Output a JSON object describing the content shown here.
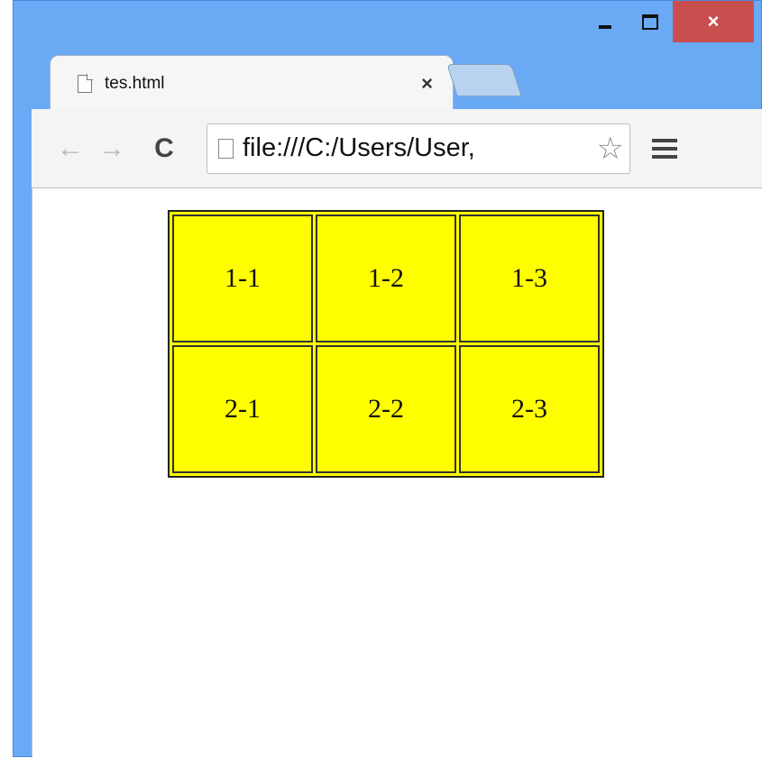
{
  "window": {
    "caption_buttons": {
      "minimize_icon": "minimize-icon",
      "maximize_icon": "maximize-icon",
      "close_glyph": "×",
      "close_color": "#c94f4f"
    }
  },
  "tab": {
    "title": "tes.html",
    "close_glyph": "×"
  },
  "toolbar": {
    "back_glyph": "←",
    "forward_glyph": "→",
    "reload_glyph": "C",
    "url": "file:///C:/Users/User,",
    "star_glyph": "☆"
  },
  "page": {
    "table_color": "#ffff00",
    "rows": [
      [
        "1-1",
        "1-2",
        "1-3"
      ],
      [
        "2-1",
        "2-2",
        "2-3"
      ]
    ]
  }
}
